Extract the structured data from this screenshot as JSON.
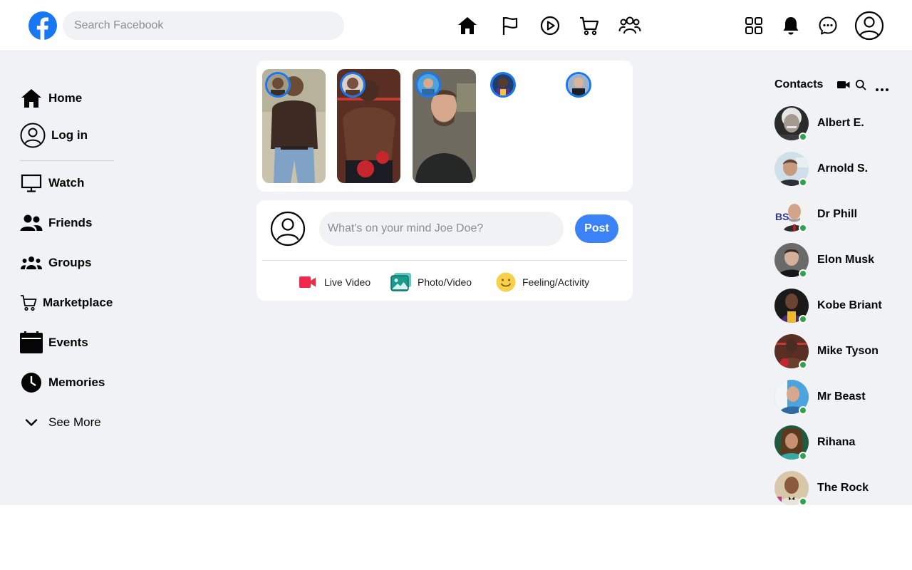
{
  "header": {
    "search": {
      "placeholder": "Search Facebook"
    },
    "brand_color": "#1877f2",
    "nav_icons": [
      "home-icon",
      "flag-icon",
      "play-icon",
      "cart-icon",
      "groups-icon"
    ],
    "right_icons": [
      "menu-grid-icon",
      "bell-icon",
      "messenger-icon",
      "profile-icon"
    ]
  },
  "sidebar": {
    "items": [
      {
        "label": "Home",
        "icon": "home-icon"
      },
      {
        "label": "Log in",
        "icon": "user-circle-icon"
      },
      {
        "label": "Watch",
        "icon": "monitor-icon"
      },
      {
        "label": "Friends",
        "icon": "friends-icon"
      },
      {
        "label": "Groups",
        "icon": "groups-icon"
      },
      {
        "label": "Marketplace",
        "icon": "cart-icon"
      },
      {
        "label": "Events",
        "icon": "calendar-icon"
      },
      {
        "label": "Memories",
        "icon": "clock-icon"
      },
      {
        "label": "See More",
        "icon": "chevron-down-icon"
      }
    ]
  },
  "composer": {
    "placeholder": "What's on your mind Joe Doe?",
    "post_label": "Post",
    "actions": [
      {
        "label": "Live Video",
        "icon": "video-icon",
        "color": "#f02849"
      },
      {
        "label": "Photo/Video",
        "icon": "photo-icon",
        "color": "#45bd62"
      },
      {
        "label": "Feeling/Activity",
        "icon": "smile-icon",
        "color": "#f7b928"
      }
    ]
  },
  "contacts": {
    "title": "Contacts",
    "header_icons": [
      "video-camera-icon",
      "search-icon",
      "more-icon"
    ],
    "online_color": "#31a24c",
    "list": [
      {
        "name": "Albert E."
      },
      {
        "name": "Arnold S."
      },
      {
        "name": "Dr Phill"
      },
      {
        "name": "Elon Musk"
      },
      {
        "name": "Kobe Briant"
      },
      {
        "name": "Mike Tyson"
      },
      {
        "name": "Mr Beast"
      },
      {
        "name": "Rihana"
      },
      {
        "name": "The Rock"
      }
    ]
  }
}
